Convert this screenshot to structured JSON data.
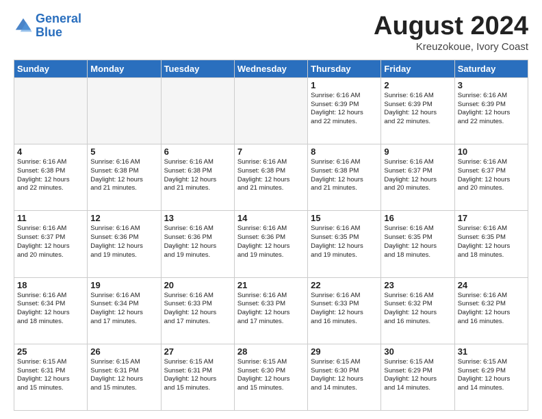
{
  "header": {
    "logo_line1": "General",
    "logo_line2": "Blue",
    "title": "August 2024",
    "subtitle": "Kreuzokoue, Ivory Coast"
  },
  "weekdays": [
    "Sunday",
    "Monday",
    "Tuesday",
    "Wednesday",
    "Thursday",
    "Friday",
    "Saturday"
  ],
  "weeks": [
    [
      {
        "day": "",
        "info": ""
      },
      {
        "day": "",
        "info": ""
      },
      {
        "day": "",
        "info": ""
      },
      {
        "day": "",
        "info": ""
      },
      {
        "day": "1",
        "info": "Sunrise: 6:16 AM\nSunset: 6:39 PM\nDaylight: 12 hours\nand 22 minutes."
      },
      {
        "day": "2",
        "info": "Sunrise: 6:16 AM\nSunset: 6:39 PM\nDaylight: 12 hours\nand 22 minutes."
      },
      {
        "day": "3",
        "info": "Sunrise: 6:16 AM\nSunset: 6:39 PM\nDaylight: 12 hours\nand 22 minutes."
      }
    ],
    [
      {
        "day": "4",
        "info": "Sunrise: 6:16 AM\nSunset: 6:38 PM\nDaylight: 12 hours\nand 22 minutes."
      },
      {
        "day": "5",
        "info": "Sunrise: 6:16 AM\nSunset: 6:38 PM\nDaylight: 12 hours\nand 21 minutes."
      },
      {
        "day": "6",
        "info": "Sunrise: 6:16 AM\nSunset: 6:38 PM\nDaylight: 12 hours\nand 21 minutes."
      },
      {
        "day": "7",
        "info": "Sunrise: 6:16 AM\nSunset: 6:38 PM\nDaylight: 12 hours\nand 21 minutes."
      },
      {
        "day": "8",
        "info": "Sunrise: 6:16 AM\nSunset: 6:38 PM\nDaylight: 12 hours\nand 21 minutes."
      },
      {
        "day": "9",
        "info": "Sunrise: 6:16 AM\nSunset: 6:37 PM\nDaylight: 12 hours\nand 20 minutes."
      },
      {
        "day": "10",
        "info": "Sunrise: 6:16 AM\nSunset: 6:37 PM\nDaylight: 12 hours\nand 20 minutes."
      }
    ],
    [
      {
        "day": "11",
        "info": "Sunrise: 6:16 AM\nSunset: 6:37 PM\nDaylight: 12 hours\nand 20 minutes."
      },
      {
        "day": "12",
        "info": "Sunrise: 6:16 AM\nSunset: 6:36 PM\nDaylight: 12 hours\nand 19 minutes."
      },
      {
        "day": "13",
        "info": "Sunrise: 6:16 AM\nSunset: 6:36 PM\nDaylight: 12 hours\nand 19 minutes."
      },
      {
        "day": "14",
        "info": "Sunrise: 6:16 AM\nSunset: 6:36 PM\nDaylight: 12 hours\nand 19 minutes."
      },
      {
        "day": "15",
        "info": "Sunrise: 6:16 AM\nSunset: 6:35 PM\nDaylight: 12 hours\nand 19 minutes."
      },
      {
        "day": "16",
        "info": "Sunrise: 6:16 AM\nSunset: 6:35 PM\nDaylight: 12 hours\nand 18 minutes."
      },
      {
        "day": "17",
        "info": "Sunrise: 6:16 AM\nSunset: 6:35 PM\nDaylight: 12 hours\nand 18 minutes."
      }
    ],
    [
      {
        "day": "18",
        "info": "Sunrise: 6:16 AM\nSunset: 6:34 PM\nDaylight: 12 hours\nand 18 minutes."
      },
      {
        "day": "19",
        "info": "Sunrise: 6:16 AM\nSunset: 6:34 PM\nDaylight: 12 hours\nand 17 minutes."
      },
      {
        "day": "20",
        "info": "Sunrise: 6:16 AM\nSunset: 6:33 PM\nDaylight: 12 hours\nand 17 minutes."
      },
      {
        "day": "21",
        "info": "Sunrise: 6:16 AM\nSunset: 6:33 PM\nDaylight: 12 hours\nand 17 minutes."
      },
      {
        "day": "22",
        "info": "Sunrise: 6:16 AM\nSunset: 6:33 PM\nDaylight: 12 hours\nand 16 minutes."
      },
      {
        "day": "23",
        "info": "Sunrise: 6:16 AM\nSunset: 6:32 PM\nDaylight: 12 hours\nand 16 minutes."
      },
      {
        "day": "24",
        "info": "Sunrise: 6:16 AM\nSunset: 6:32 PM\nDaylight: 12 hours\nand 16 minutes."
      }
    ],
    [
      {
        "day": "25",
        "info": "Sunrise: 6:15 AM\nSunset: 6:31 PM\nDaylight: 12 hours\nand 15 minutes."
      },
      {
        "day": "26",
        "info": "Sunrise: 6:15 AM\nSunset: 6:31 PM\nDaylight: 12 hours\nand 15 minutes."
      },
      {
        "day": "27",
        "info": "Sunrise: 6:15 AM\nSunset: 6:31 PM\nDaylight: 12 hours\nand 15 minutes."
      },
      {
        "day": "28",
        "info": "Sunrise: 6:15 AM\nSunset: 6:30 PM\nDaylight: 12 hours\nand 15 minutes."
      },
      {
        "day": "29",
        "info": "Sunrise: 6:15 AM\nSunset: 6:30 PM\nDaylight: 12 hours\nand 14 minutes."
      },
      {
        "day": "30",
        "info": "Sunrise: 6:15 AM\nSunset: 6:29 PM\nDaylight: 12 hours\nand 14 minutes."
      },
      {
        "day": "31",
        "info": "Sunrise: 6:15 AM\nSunset: 6:29 PM\nDaylight: 12 hours\nand 14 minutes."
      }
    ]
  ]
}
